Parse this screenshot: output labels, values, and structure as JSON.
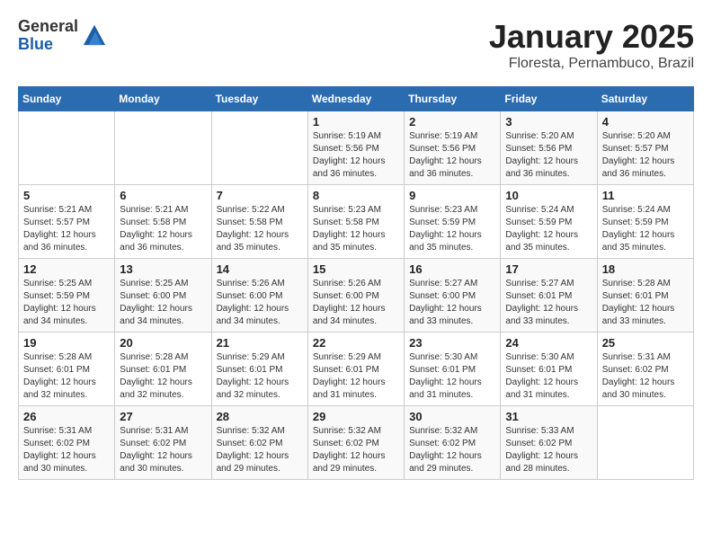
{
  "logo": {
    "general": "General",
    "blue": "Blue"
  },
  "header": {
    "month": "January 2025",
    "location": "Floresta, Pernambuco, Brazil"
  },
  "weekdays": [
    "Sunday",
    "Monday",
    "Tuesday",
    "Wednesday",
    "Thursday",
    "Friday",
    "Saturday"
  ],
  "weeks": [
    [
      {
        "day": "",
        "info": ""
      },
      {
        "day": "",
        "info": ""
      },
      {
        "day": "",
        "info": ""
      },
      {
        "day": "1",
        "info": "Sunrise: 5:19 AM\nSunset: 5:56 PM\nDaylight: 12 hours\nand 36 minutes."
      },
      {
        "day": "2",
        "info": "Sunrise: 5:19 AM\nSunset: 5:56 PM\nDaylight: 12 hours\nand 36 minutes."
      },
      {
        "day": "3",
        "info": "Sunrise: 5:20 AM\nSunset: 5:56 PM\nDaylight: 12 hours\nand 36 minutes."
      },
      {
        "day": "4",
        "info": "Sunrise: 5:20 AM\nSunset: 5:57 PM\nDaylight: 12 hours\nand 36 minutes."
      }
    ],
    [
      {
        "day": "5",
        "info": "Sunrise: 5:21 AM\nSunset: 5:57 PM\nDaylight: 12 hours\nand 36 minutes."
      },
      {
        "day": "6",
        "info": "Sunrise: 5:21 AM\nSunset: 5:58 PM\nDaylight: 12 hours\nand 36 minutes."
      },
      {
        "day": "7",
        "info": "Sunrise: 5:22 AM\nSunset: 5:58 PM\nDaylight: 12 hours\nand 35 minutes."
      },
      {
        "day": "8",
        "info": "Sunrise: 5:23 AM\nSunset: 5:58 PM\nDaylight: 12 hours\nand 35 minutes."
      },
      {
        "day": "9",
        "info": "Sunrise: 5:23 AM\nSunset: 5:59 PM\nDaylight: 12 hours\nand 35 minutes."
      },
      {
        "day": "10",
        "info": "Sunrise: 5:24 AM\nSunset: 5:59 PM\nDaylight: 12 hours\nand 35 minutes."
      },
      {
        "day": "11",
        "info": "Sunrise: 5:24 AM\nSunset: 5:59 PM\nDaylight: 12 hours\nand 35 minutes."
      }
    ],
    [
      {
        "day": "12",
        "info": "Sunrise: 5:25 AM\nSunset: 5:59 PM\nDaylight: 12 hours\nand 34 minutes."
      },
      {
        "day": "13",
        "info": "Sunrise: 5:25 AM\nSunset: 6:00 PM\nDaylight: 12 hours\nand 34 minutes."
      },
      {
        "day": "14",
        "info": "Sunrise: 5:26 AM\nSunset: 6:00 PM\nDaylight: 12 hours\nand 34 minutes."
      },
      {
        "day": "15",
        "info": "Sunrise: 5:26 AM\nSunset: 6:00 PM\nDaylight: 12 hours\nand 34 minutes."
      },
      {
        "day": "16",
        "info": "Sunrise: 5:27 AM\nSunset: 6:00 PM\nDaylight: 12 hours\nand 33 minutes."
      },
      {
        "day": "17",
        "info": "Sunrise: 5:27 AM\nSunset: 6:01 PM\nDaylight: 12 hours\nand 33 minutes."
      },
      {
        "day": "18",
        "info": "Sunrise: 5:28 AM\nSunset: 6:01 PM\nDaylight: 12 hours\nand 33 minutes."
      }
    ],
    [
      {
        "day": "19",
        "info": "Sunrise: 5:28 AM\nSunset: 6:01 PM\nDaylight: 12 hours\nand 32 minutes."
      },
      {
        "day": "20",
        "info": "Sunrise: 5:28 AM\nSunset: 6:01 PM\nDaylight: 12 hours\nand 32 minutes."
      },
      {
        "day": "21",
        "info": "Sunrise: 5:29 AM\nSunset: 6:01 PM\nDaylight: 12 hours\nand 32 minutes."
      },
      {
        "day": "22",
        "info": "Sunrise: 5:29 AM\nSunset: 6:01 PM\nDaylight: 12 hours\nand 31 minutes."
      },
      {
        "day": "23",
        "info": "Sunrise: 5:30 AM\nSunset: 6:01 PM\nDaylight: 12 hours\nand 31 minutes."
      },
      {
        "day": "24",
        "info": "Sunrise: 5:30 AM\nSunset: 6:01 PM\nDaylight: 12 hours\nand 31 minutes."
      },
      {
        "day": "25",
        "info": "Sunrise: 5:31 AM\nSunset: 6:02 PM\nDaylight: 12 hours\nand 30 minutes."
      }
    ],
    [
      {
        "day": "26",
        "info": "Sunrise: 5:31 AM\nSunset: 6:02 PM\nDaylight: 12 hours\nand 30 minutes."
      },
      {
        "day": "27",
        "info": "Sunrise: 5:31 AM\nSunset: 6:02 PM\nDaylight: 12 hours\nand 30 minutes."
      },
      {
        "day": "28",
        "info": "Sunrise: 5:32 AM\nSunset: 6:02 PM\nDaylight: 12 hours\nand 29 minutes."
      },
      {
        "day": "29",
        "info": "Sunrise: 5:32 AM\nSunset: 6:02 PM\nDaylight: 12 hours\nand 29 minutes."
      },
      {
        "day": "30",
        "info": "Sunrise: 5:32 AM\nSunset: 6:02 PM\nDaylight: 12 hours\nand 29 minutes."
      },
      {
        "day": "31",
        "info": "Sunrise: 5:33 AM\nSunset: 6:02 PM\nDaylight: 12 hours\nand 28 minutes."
      },
      {
        "day": "",
        "info": ""
      }
    ]
  ]
}
